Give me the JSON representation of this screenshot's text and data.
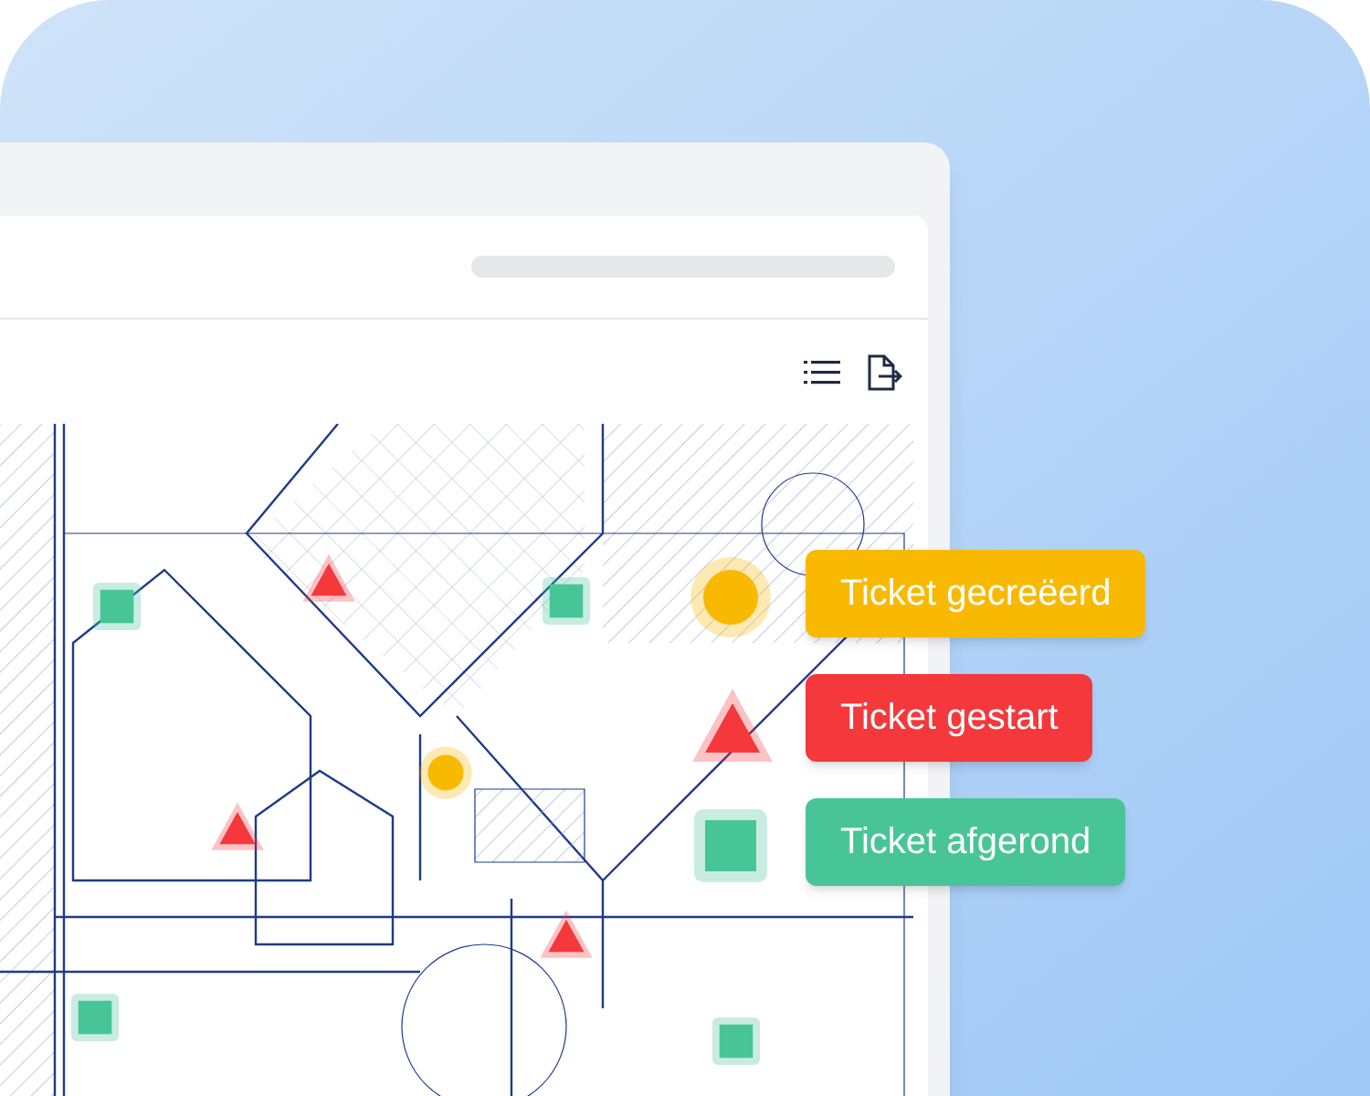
{
  "toolbar": {
    "icons": [
      {
        "kind": "list"
      },
      {
        "kind": "export"
      }
    ]
  },
  "markers": [
    {
      "kind": "done"
    },
    {
      "kind": "done"
    },
    {
      "kind": "done"
    },
    {
      "kind": "done"
    },
    {
      "kind": "done"
    },
    {
      "kind": "started"
    },
    {
      "kind": "started"
    },
    {
      "kind": "started"
    },
    {
      "kind": "started"
    },
    {
      "kind": "created"
    },
    {
      "kind": "created"
    }
  ],
  "legend": [
    {
      "kind": "created",
      "label": "Ticket gecreëerd"
    },
    {
      "kind": "started",
      "label": "Ticket gestart"
    },
    {
      "kind": "done",
      "label": "Ticket afgerond"
    }
  ]
}
